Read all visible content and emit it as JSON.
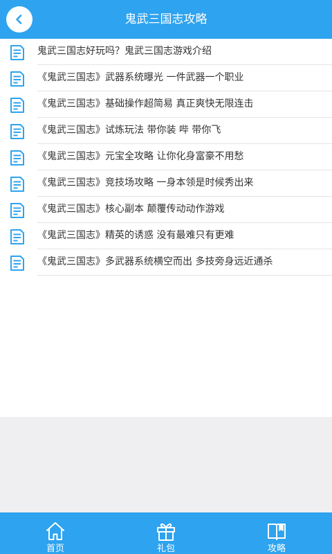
{
  "header": {
    "title": "鬼武三国志攻略"
  },
  "colors": {
    "primary": "#2ea3ef",
    "icon": "#2ea3ef",
    "text": "#333333",
    "divider": "#e4e4e4",
    "background_grey": "#efeff1"
  },
  "articles": [
    {
      "title": "鬼武三国志好玩吗？鬼武三国志游戏介绍",
      "icon": "document-icon"
    },
    {
      "title": "《鬼武三国志》武器系统曝光 一件武器一个职业",
      "icon": "document-icon"
    },
    {
      "title": "《鬼武三国志》基础操作超简易 真正爽快无限连击",
      "icon": "document-icon"
    },
    {
      "title": "《鬼武三国志》试炼玩法 带你装 哔 带你飞",
      "icon": "document-icon"
    },
    {
      "title": "《鬼武三国志》元宝全攻略 让你化身富豪不用愁",
      "icon": "document-icon"
    },
    {
      "title": "《鬼武三国志》竞技场攻略 一身本领是时候秀出来",
      "icon": "document-icon"
    },
    {
      "title": "《鬼武三国志》核心副本 颠覆传动动作游戏",
      "icon": "document-icon"
    },
    {
      "title": "《鬼武三国志》精英的诱惑 没有最难只有更难",
      "icon": "document-icon"
    },
    {
      "title": "《鬼武三国志》多武器系统横空而出 多技旁身远近通杀",
      "icon": "document-icon"
    }
  ],
  "bottom_nav": {
    "items": [
      {
        "label": "首页",
        "icon": "home-icon"
      },
      {
        "label": "礼包",
        "icon": "gift-icon"
      },
      {
        "label": "攻略",
        "icon": "book-icon"
      }
    ]
  }
}
